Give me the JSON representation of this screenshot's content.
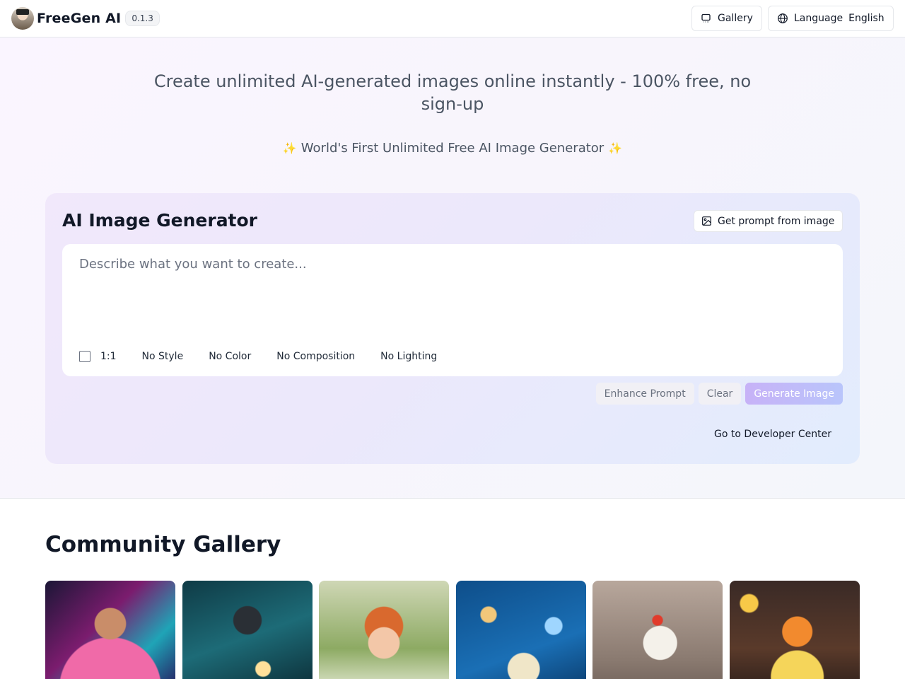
{
  "header": {
    "app_name": "FreeGen AI",
    "version": "0.1.3",
    "gallery_label": "Gallery",
    "language_label": "Language",
    "language_value": "English"
  },
  "hero": {
    "tagline": "Create unlimited AI-generated images online instantly - 100% free, no sign-up",
    "subtitle": "World's First Unlimited Free AI Image Generator"
  },
  "generator": {
    "title": "AI Image Generator",
    "prompt_from_image_label": "Get prompt from image",
    "prompt_placeholder": "Describe what you want to create...",
    "prompt_value": "",
    "options": {
      "aspect_ratio": "1:1",
      "style": "No Style",
      "color": "No Color",
      "composition": "No Composition",
      "lighting": "No Lighting"
    },
    "enhance_label": "Enhance Prompt",
    "clear_label": "Clear",
    "generate_label": "Generate Image",
    "developer_link": "Go to Developer Center"
  },
  "gallery": {
    "title": "Community Gallery",
    "images": [
      {
        "name": "neon-portrait-image"
      },
      {
        "name": "underwater-welder-image"
      },
      {
        "name": "baby-in-flowers-image"
      },
      {
        "name": "diamonds-image"
      },
      {
        "name": "rooster-singer-image"
      },
      {
        "name": "anime-girl-image"
      }
    ]
  },
  "colors": {
    "accent": "#c7b2f7",
    "text": "#111827",
    "muted": "#6b7280"
  }
}
